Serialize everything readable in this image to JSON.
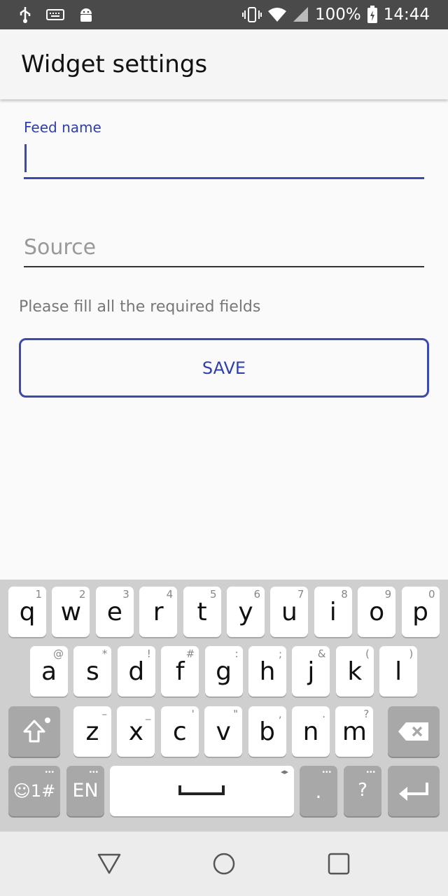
{
  "status_bar": {
    "icons_left": [
      "usb-icon",
      "keyboard-icon",
      "android-icon"
    ],
    "battery_percent": "100%",
    "time": "14:44",
    "icons_right": [
      "vibrate-icon",
      "wifi-icon",
      "signal-icon",
      "battery-charging-icon"
    ]
  },
  "app_bar": {
    "title": "Widget settings"
  },
  "form": {
    "feed_name_label": "Feed name",
    "feed_name_value": "",
    "source_placeholder": "Source",
    "help_text": "Please fill all the required fields",
    "save_label": "SAVE"
  },
  "keyboard": {
    "row1": [
      {
        "key": "q",
        "sup": "1"
      },
      {
        "key": "w",
        "sup": "2"
      },
      {
        "key": "e",
        "sup": "3"
      },
      {
        "key": "r",
        "sup": "4"
      },
      {
        "key": "t",
        "sup": "5"
      },
      {
        "key": "y",
        "sup": "6"
      },
      {
        "key": "u",
        "sup": "7"
      },
      {
        "key": "i",
        "sup": "8"
      },
      {
        "key": "o",
        "sup": "9"
      },
      {
        "key": "p",
        "sup": "0"
      }
    ],
    "row2": [
      {
        "key": "a",
        "sup": "@"
      },
      {
        "key": "s",
        "sup": "*"
      },
      {
        "key": "d",
        "sup": "!"
      },
      {
        "key": "f",
        "sup": "#"
      },
      {
        "key": "g",
        "sup": ":"
      },
      {
        "key": "h",
        "sup": ";"
      },
      {
        "key": "j",
        "sup": "&"
      },
      {
        "key": "k",
        "sup": "("
      },
      {
        "key": "l",
        "sup": ")"
      }
    ],
    "row3": [
      {
        "key": "z",
        "sup": "–"
      },
      {
        "key": "x",
        "sup": "_"
      },
      {
        "key": "c",
        "sup": "'"
      },
      {
        "key": "v",
        "sup": "\""
      },
      {
        "key": "b",
        "sup": ","
      },
      {
        "key": "n",
        "sup": "."
      },
      {
        "key": "m",
        "sup": "?"
      }
    ],
    "symbols_label": "☺1#",
    "language_label": "EN",
    "period_label": ".",
    "question_label": "?"
  },
  "colors": {
    "accent": "#3a4aad",
    "status_bar": "#4a4a4a",
    "keyboard_bg": "#cfcfcf"
  }
}
